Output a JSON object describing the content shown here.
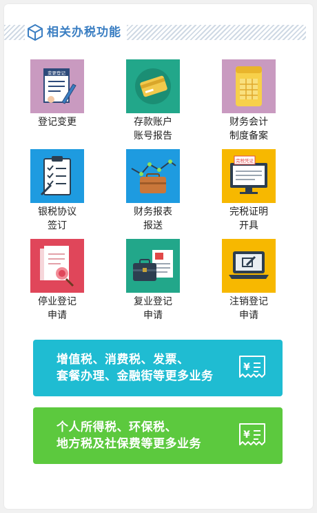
{
  "section": {
    "title": "相关办税功能"
  },
  "tiles": [
    {
      "line1": "登记变更",
      "line2": "",
      "bg": "#c99ac0",
      "icon": "registration-form-icon"
    },
    {
      "line1": "存款账户",
      "line2": "账号报告",
      "bg": "#22a78a",
      "icon": "bank-card-icon"
    },
    {
      "line1": "财务会计",
      "line2": "制度备案",
      "bg": "#c99ac0",
      "icon": "ledger-book-icon"
    },
    {
      "line1": "银税协议",
      "line2": "签订",
      "bg": "#1e9be0",
      "icon": "clipboard-checklist-icon"
    },
    {
      "line1": "财务报表",
      "line2": "报送",
      "bg": "#1e9be0",
      "icon": "briefcase-chart-icon"
    },
    {
      "line1": "完税证明",
      "line2": "开具",
      "bg": "#f7b800",
      "icon": "tax-certificate-monitor-icon"
    },
    {
      "line1": "停业登记",
      "line2": "申请",
      "bg": "#e0465a",
      "icon": "document-seal-icon"
    },
    {
      "line1": "复业登记",
      "line2": "申请",
      "bg": "#22a78a",
      "icon": "briefcase-newspaper-icon"
    },
    {
      "line1": "注销登记",
      "line2": "申请",
      "bg": "#f7b800",
      "icon": "laptop-edit-icon"
    }
  ],
  "tile_texts": {
    "form_title": "变更登记",
    "cert_title": "完税凭证"
  },
  "banners": [
    {
      "line1": "增值税、消费税、发票、",
      "line2": "套餐办理、金融街等更多业务",
      "bg": "#1fbcd2",
      "icon": "tax-receipt-icon"
    },
    {
      "line1": "个人所得税、环保税、",
      "line2": "地方税及社保费等更多业务",
      "bg": "#5cc93e",
      "icon": "tax-receipt-icon"
    }
  ]
}
